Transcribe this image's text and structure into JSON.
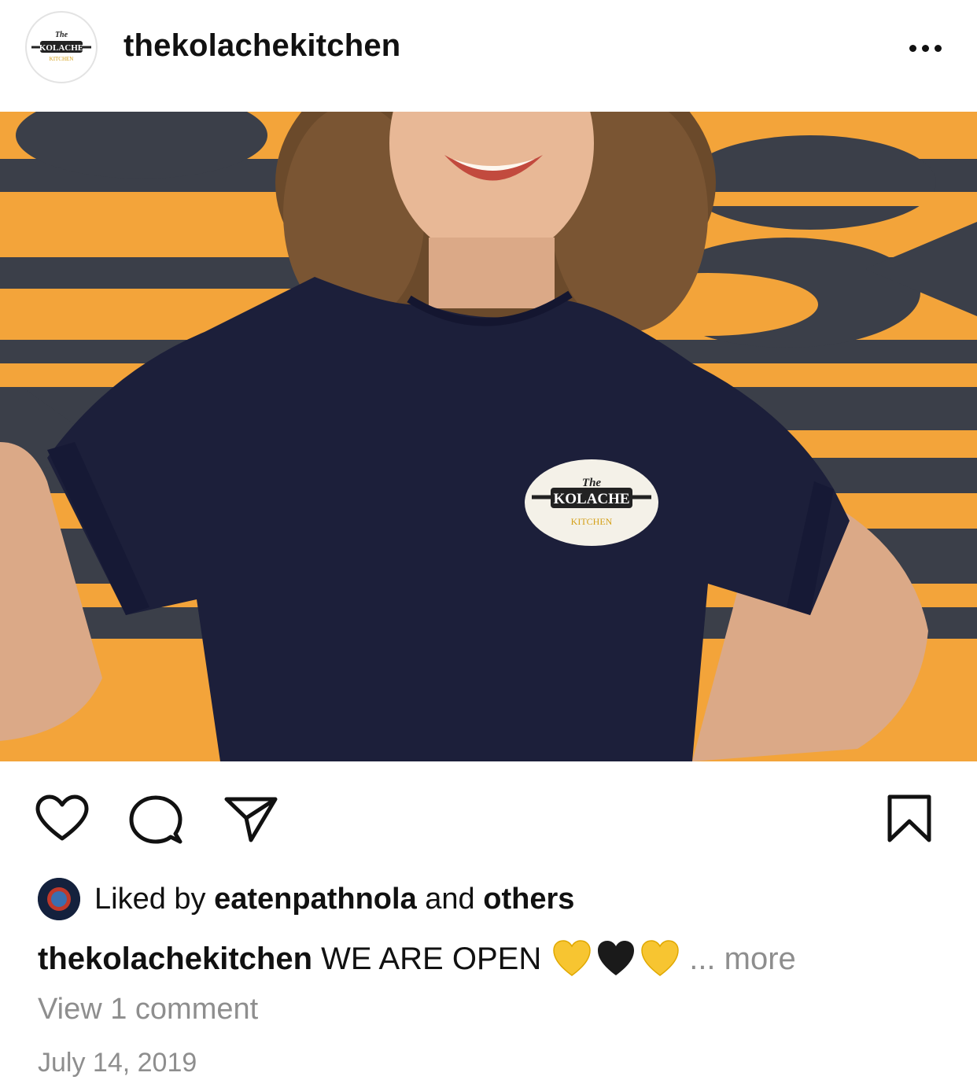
{
  "post": {
    "username": "thekolachekitchen",
    "avatar_logo": {
      "line1": "The",
      "line2": "KOLACHE",
      "line3": "KITCHEN"
    },
    "more_icon": "ellipsis-horizontal-icon"
  },
  "photo": {
    "shirt_logo": {
      "line1": "The",
      "line2": "KOLACHE",
      "line3": "KITCHEN"
    },
    "colors": {
      "wall_orange": "#f3a43a",
      "wall_slate": "#3b3f49",
      "shirt_navy": "#1c1f3a"
    }
  },
  "actions": {
    "like_icon": "heart-outline-icon",
    "comment_icon": "comment-bubble-icon",
    "share_icon": "paper-plane-icon",
    "save_icon": "bookmark-icon"
  },
  "likes": {
    "prefix": "Liked by",
    "user": "eatenpathnola",
    "middle": "and",
    "others": "others"
  },
  "caption": {
    "username": "thekolachekitchen",
    "text": "WE ARE OPEN",
    "emojis": [
      "yellow-heart-icon",
      "black-heart-icon",
      "yellow-heart-icon"
    ],
    "more": "... more"
  },
  "comments": {
    "link": "View 1 comment"
  },
  "date": "July 14, 2019"
}
